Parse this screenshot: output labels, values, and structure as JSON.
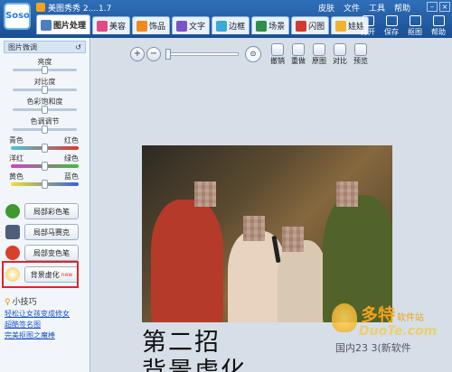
{
  "app": {
    "title": "美图秀秀 2....1.7",
    "logo_text": "Soso"
  },
  "menu": {
    "items": [
      "皮肤",
      "文件",
      "工具",
      "帮助"
    ]
  },
  "tabs": [
    {
      "label": "图片处理",
      "color": "#4a7fc1",
      "active": true
    },
    {
      "label": "美容",
      "color": "#e14a84"
    },
    {
      "label": "饰品",
      "color": "#f08a1b"
    },
    {
      "label": "文字",
      "color": "#7d52c7"
    },
    {
      "label": "边框",
      "color": "#3ba8d8"
    },
    {
      "label": "场景",
      "color": "#2f8f4a"
    },
    {
      "label": "闪图",
      "color": "#d33a2f"
    },
    {
      "label": "娃娃",
      "color": "#f0b428"
    }
  ],
  "toolbar": {
    "open": "打开",
    "save": "保存",
    "capture": "抠图",
    "help": "帮助"
  },
  "left_panel": {
    "title": "图片微调",
    "sliders": [
      {
        "label": "亮度",
        "value": 0.5
      },
      {
        "label": "对比度",
        "value": 0.5
      },
      {
        "label": "色彩饱和度",
        "value": 0.5
      },
      {
        "label": "色调调节",
        "value": 0.5
      }
    ],
    "color_sliders": [
      {
        "left": "青色",
        "right": "红色",
        "value": 0.5,
        "colors": [
          "#46c8d9",
          "#e3342c"
        ]
      },
      {
        "left": "洋红",
        "right": "绿色",
        "value": 0.5,
        "colors": [
          "#d33fc8",
          "#3fbf3a"
        ]
      },
      {
        "left": "黄色",
        "right": "蓝色",
        "value": 0.5,
        "colors": [
          "#f2e02c",
          "#3a5fe0"
        ]
      }
    ],
    "buttons": [
      {
        "label": "局部彩色笔",
        "icon_color": "#3e9a2f"
      },
      {
        "label": "局部马赛克",
        "icon_color": "#4e5e7a"
      },
      {
        "label": "局部变色笔",
        "icon_color": "#d8402c"
      },
      {
        "label": "背景虚化",
        "icon_color": "#f2ca3c",
        "badge": "new"
      }
    ]
  },
  "tips": {
    "title": "小技巧",
    "links": [
      "轻松让女孩变成修女",
      "超酷签名图",
      "完美抠图之魔棒"
    ]
  },
  "editbar": {
    "zoom_in": "+",
    "zoom_out": "−",
    "actions": [
      "撤销",
      "重做",
      "原图",
      "对比",
      "预览"
    ]
  },
  "caption": {
    "line1": "第二招",
    "line2": "背景虚化"
  },
  "watermark": {
    "brand": "多特",
    "brand_suffix": "软件站",
    "domain": "DuoTe.com",
    "footer": "国内23 3(新软件"
  }
}
